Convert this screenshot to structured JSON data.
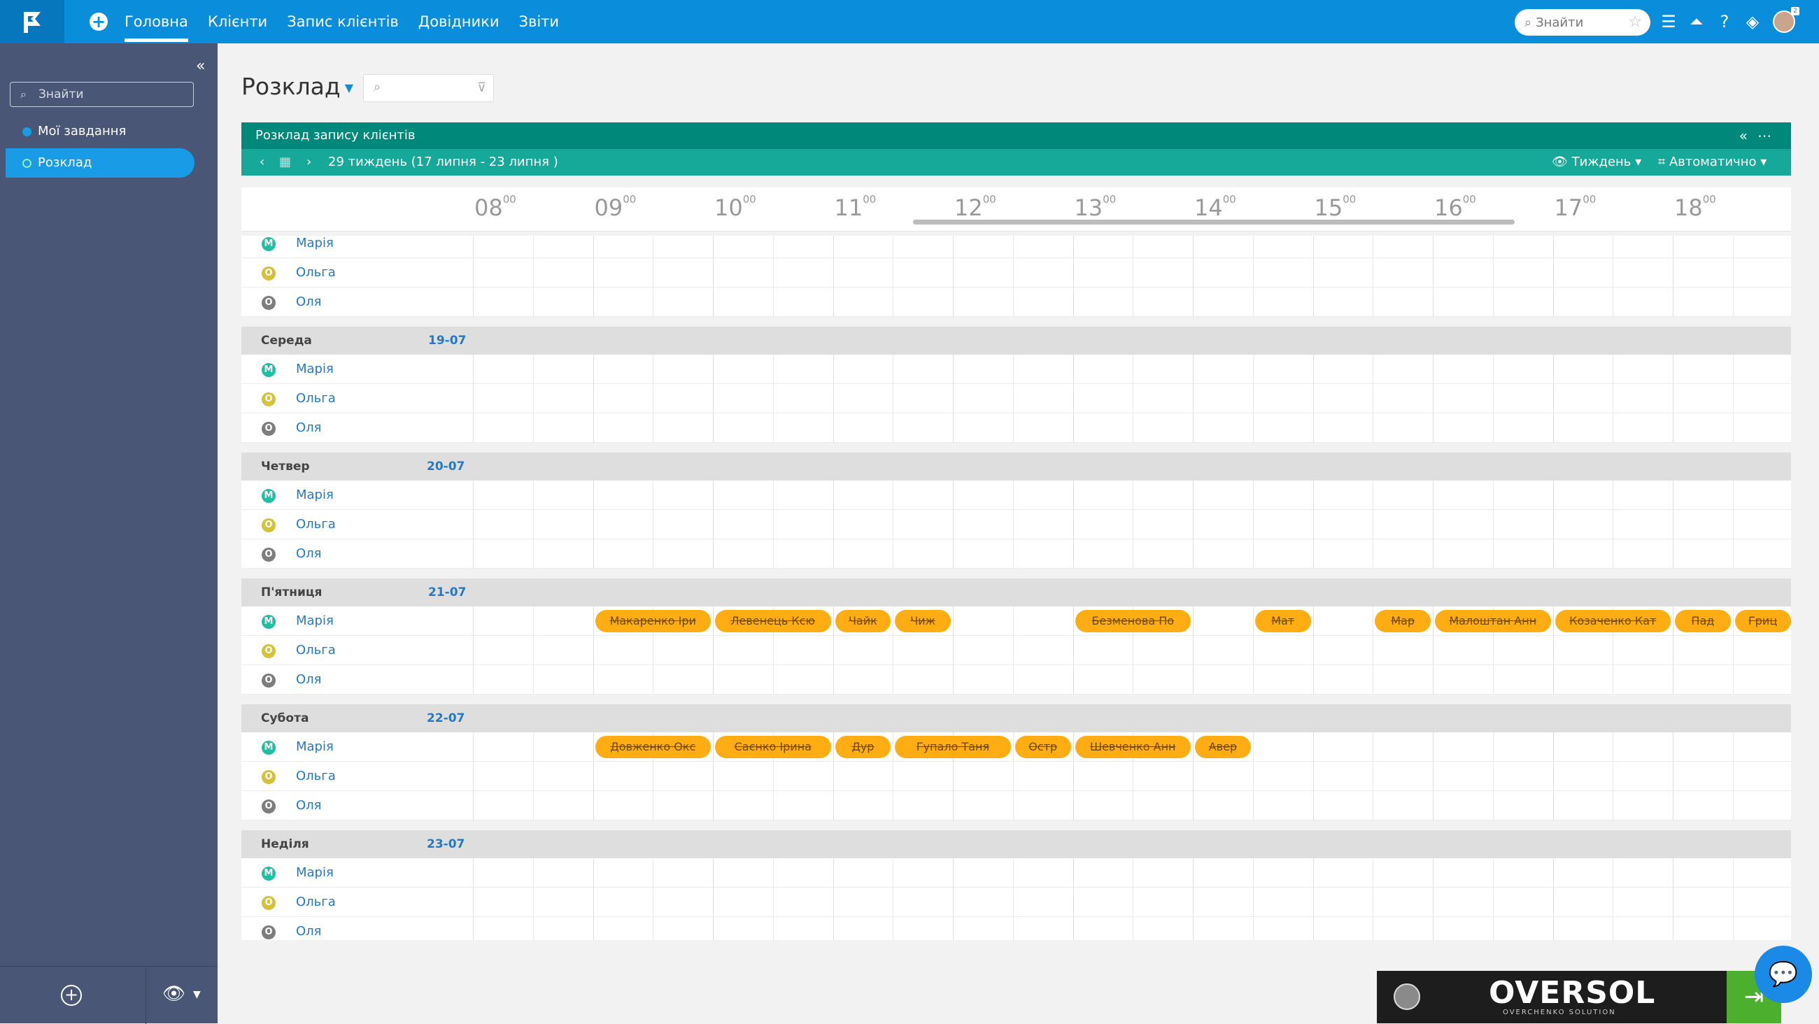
{
  "topbar": {
    "nav": [
      "Головна",
      "Клієнти",
      "Запис клієнтів",
      "Довідники",
      "Звіти"
    ],
    "search_placeholder": "Знайти",
    "badge": "2"
  },
  "sidebar": {
    "search_placeholder": "Знайти",
    "items": [
      {
        "label": "Мої завдання"
      },
      {
        "label": "Розклад"
      }
    ]
  },
  "page": {
    "title": "Розклад"
  },
  "panel": {
    "title": "Розклад запису клієнтів",
    "week": "29 тиждень  (17 липня - 23 липня )",
    "view_mode": "Тиждень",
    "auto_mode": "Автоматично"
  },
  "hours": [
    "08",
    "09",
    "10",
    "11",
    "12",
    "13",
    "14",
    "15",
    "16",
    "17",
    "18"
  ],
  "hour_suffix": "00",
  "employees": [
    {
      "name": "Марія",
      "initial": "М",
      "color": "#1fbf9f"
    },
    {
      "name": "Ольга",
      "initial": "О",
      "color": "#d6c13a"
    },
    {
      "name": "Оля",
      "initial": "О",
      "color": "#7d7d7d"
    }
  ],
  "days": [
    {
      "name": "",
      "date": "",
      "partial": true
    },
    {
      "name": "Середа",
      "date": "19-07"
    },
    {
      "name": "Четвер",
      "date": "20-07"
    },
    {
      "name": "П'ятниця",
      "date": "21-07"
    },
    {
      "name": "Субота",
      "date": "22-07"
    },
    {
      "name": "Неділя",
      "date": "23-07"
    }
  ],
  "appointments": [
    {
      "day": 3,
      "row": 0,
      "start": 9.0,
      "end": 10.0,
      "label": "Макаренко Іри"
    },
    {
      "day": 3,
      "row": 0,
      "start": 10.0,
      "end": 11.0,
      "label": "Левенець Ксю"
    },
    {
      "day": 3,
      "row": 0,
      "start": 11.0,
      "end": 11.5,
      "label": "Чайк"
    },
    {
      "day": 3,
      "row": 0,
      "start": 11.5,
      "end": 12.0,
      "label": "Чиж"
    },
    {
      "day": 3,
      "row": 0,
      "start": 13.0,
      "end": 14.0,
      "label": "Безменова По"
    },
    {
      "day": 3,
      "row": 0,
      "start": 14.5,
      "end": 15.0,
      "label": "Мат"
    },
    {
      "day": 3,
      "row": 0,
      "start": 15.5,
      "end": 16.0,
      "label": "Мар"
    },
    {
      "day": 3,
      "row": 0,
      "start": 16.0,
      "end": 17.0,
      "label": "Малоштан Анн"
    },
    {
      "day": 3,
      "row": 0,
      "start": 17.0,
      "end": 18.0,
      "label": "Козаченко Кат"
    },
    {
      "day": 3,
      "row": 0,
      "start": 18.0,
      "end": 18.5,
      "label": "Пад"
    },
    {
      "day": 3,
      "row": 0,
      "start": 18.5,
      "end": 19.0,
      "label": "Гриц"
    },
    {
      "day": 4,
      "row": 0,
      "start": 9.0,
      "end": 10.0,
      "label": "Довженко Окс"
    },
    {
      "day": 4,
      "row": 0,
      "start": 10.0,
      "end": 11.0,
      "label": "Саєнко Ірина"
    },
    {
      "day": 4,
      "row": 0,
      "start": 11.0,
      "end": 11.5,
      "label": "Дур"
    },
    {
      "day": 4,
      "row": 0,
      "start": 11.5,
      "end": 12.5,
      "label": "Гупало Таня"
    },
    {
      "day": 4,
      "row": 0,
      "start": 12.5,
      "end": 13.0,
      "label": "Остр"
    },
    {
      "day": 4,
      "row": 0,
      "start": 13.0,
      "end": 14.0,
      "label": "Шевченко Анн"
    },
    {
      "day": 4,
      "row": 0,
      "start": 14.0,
      "end": 14.5,
      "label": "Авер"
    }
  ],
  "footer": {
    "brand": "OVERSOL",
    "brand_sub": "OVERCHENKO SOLUTION"
  },
  "colors": {
    "primary": "#0a8edc",
    "panel": "#00897b",
    "panel_sub": "#16a898",
    "appointment": "#ffad12",
    "sidebar": "#4a5675"
  },
  "icons": {
    "logo": "flag-logo",
    "search": "search-icon",
    "star": "star-icon",
    "menu": "menu-icon",
    "rocket": "rocket-icon",
    "help": "help-icon",
    "layers": "layers-icon",
    "filter": "filter-icon",
    "calendar": "calendar-icon",
    "eye": "eye-icon",
    "chat": "chat-icon",
    "exit": "exit-icon"
  }
}
